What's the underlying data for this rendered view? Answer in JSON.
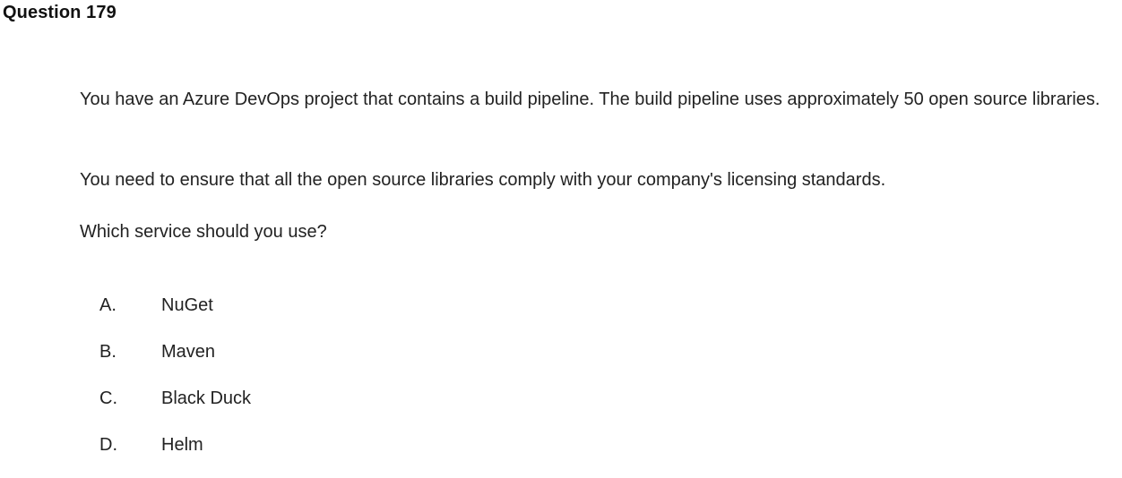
{
  "question": {
    "title": "Question 179",
    "paragraphs": [
      "You have an Azure DevOps project that contains a build pipeline. The build pipeline uses approximately 50 open source libraries.",
      "You need to ensure that all the open source libraries comply with your company's licensing standards.",
      "Which service should you use?"
    ],
    "options": [
      {
        "letter": "A.",
        "text": "NuGet"
      },
      {
        "letter": "B.",
        "text": "Maven"
      },
      {
        "letter": "C.",
        "text": "Black Duck"
      },
      {
        "letter": "D.",
        "text": "Helm"
      }
    ]
  }
}
